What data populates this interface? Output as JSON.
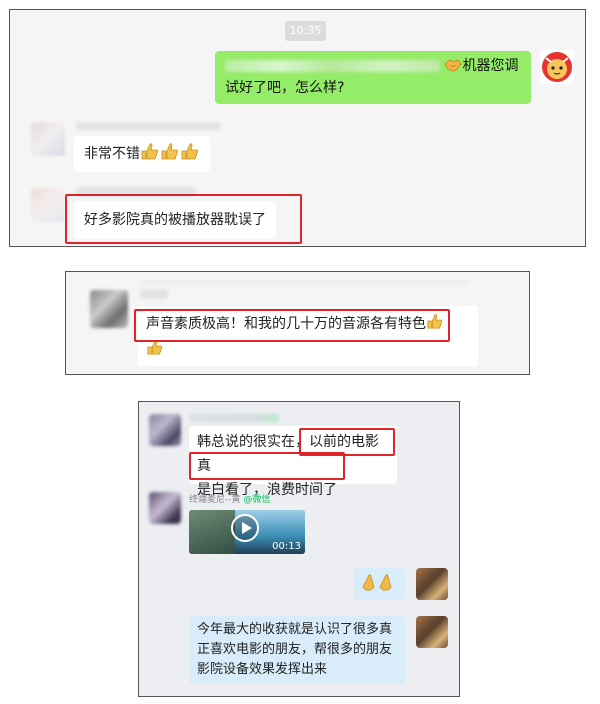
{
  "panel1": {
    "time": "10:35",
    "outgoing_line1_tail": "机器您调",
    "outgoing_line2": "试好了吧，怎么样?",
    "reply1": "非常不错",
    "reply2": "好多影院真的被播放器耽误了"
  },
  "panel2": {
    "message_line1": "声音素质极高！和我的几十万的音源各有特色"
  },
  "panel3": {
    "msg1_line1": "韩总说的很实在，以前的电影真",
    "msg1_line2": "是白看了，浪费时间了",
    "sender2_name": "终端麦尼--黄",
    "sender2_source": "@微信",
    "video_duration": "00:13",
    "reply_line1": "今年最大的收获就是认识了很多真",
    "reply_line2": "正喜欢电影的朋友，帮很多的朋友",
    "reply_line3": "影院设备效果发挥出来"
  },
  "colors": {
    "highlight_red": "#e0252a",
    "outgoing_green": "#95ec69",
    "reply_blue": "#d8ecf9",
    "wechat_green": "#07c160"
  },
  "icons": [
    "handshake-emoji-icon",
    "thumbs-up-emoji-icon",
    "clap-emoji-icon",
    "play-icon"
  ]
}
